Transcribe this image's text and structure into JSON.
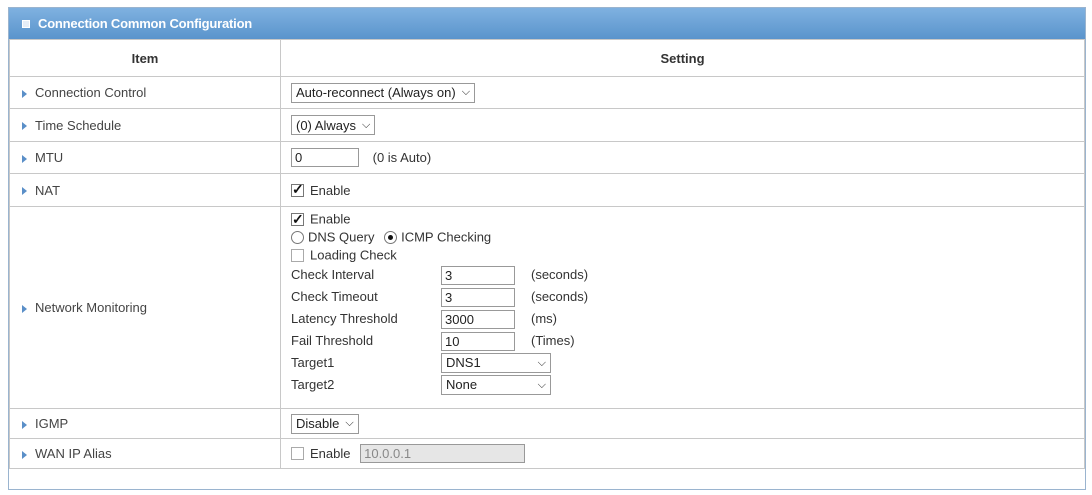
{
  "title": "Connection Common Configuration",
  "headers": {
    "item": "Item",
    "setting": "Setting"
  },
  "rows": {
    "connection_control": {
      "label": "Connection Control",
      "value": "Auto-reconnect (Always on)"
    },
    "time_schedule": {
      "label": "Time Schedule",
      "value": "(0) Always"
    },
    "mtu": {
      "label": "MTU",
      "value": "0",
      "hint": "(0 is Auto)"
    },
    "nat": {
      "label": "NAT",
      "enable_label": "Enable",
      "checked": true
    },
    "network_monitoring": {
      "label": "Network Monitoring",
      "enable_label": "Enable",
      "enable_checked": true,
      "dns_query_label": "DNS Query",
      "icmp_label": "ICMP Checking",
      "selected_method": "ICMP Checking",
      "loading_check_label": "Loading Check",
      "loading_check_checked": false,
      "check_interval": {
        "label": "Check Interval",
        "value": "3",
        "unit": "(seconds)"
      },
      "check_timeout": {
        "label": "Check Timeout",
        "value": "3",
        "unit": "(seconds)"
      },
      "latency_threshold": {
        "label": "Latency Threshold",
        "value": "3000",
        "unit": "(ms)"
      },
      "fail_threshold": {
        "label": "Fail Threshold",
        "value": "10",
        "unit": "(Times)"
      },
      "target1": {
        "label": "Target1",
        "value": "DNS1"
      },
      "target2": {
        "label": "Target2",
        "value": "None"
      }
    },
    "igmp": {
      "label": "IGMP",
      "value": "Disable"
    },
    "wan_ip_alias": {
      "label": "WAN IP Alias",
      "enable_label": "Enable",
      "checked": false,
      "value": "10.0.0.1"
    }
  },
  "icons": {
    "title_icon": "square-icon",
    "row_marker": "triangle-right-icon",
    "dropdown": "chevron-down-icon"
  },
  "colors": {
    "title_bar": "#6aa2d6",
    "border": "#c8c8c8",
    "row_marker": "#5a8fc8"
  }
}
